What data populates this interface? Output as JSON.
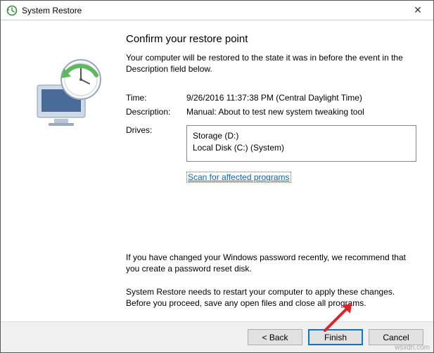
{
  "window": {
    "title": "System Restore",
    "close_glyph": "✕"
  },
  "heading": "Confirm your restore point",
  "subtext": "Your computer will be restored to the state it was in before the event in the Description field below.",
  "fields": {
    "time_label": "Time:",
    "time_value": "9/26/2016 11:37:38 PM (Central Daylight Time)",
    "desc_label": "Description:",
    "desc_value": "Manual: About to test new system tweaking tool",
    "drives_label": "Drives:",
    "drives": [
      "Storage (D:)",
      "Local Disk (C:) (System)"
    ]
  },
  "scan_link": "Scan for affected programs",
  "pw_note": "If you have changed your Windows password recently, we recommend that you create a password reset disk.",
  "restart_note": "System Restore needs to restart your computer to apply these changes. Before you proceed, save any open files and close all programs.",
  "buttons": {
    "back": "< Back",
    "finish": "Finish",
    "cancel": "Cancel"
  },
  "watermark": "wsxdn.com"
}
